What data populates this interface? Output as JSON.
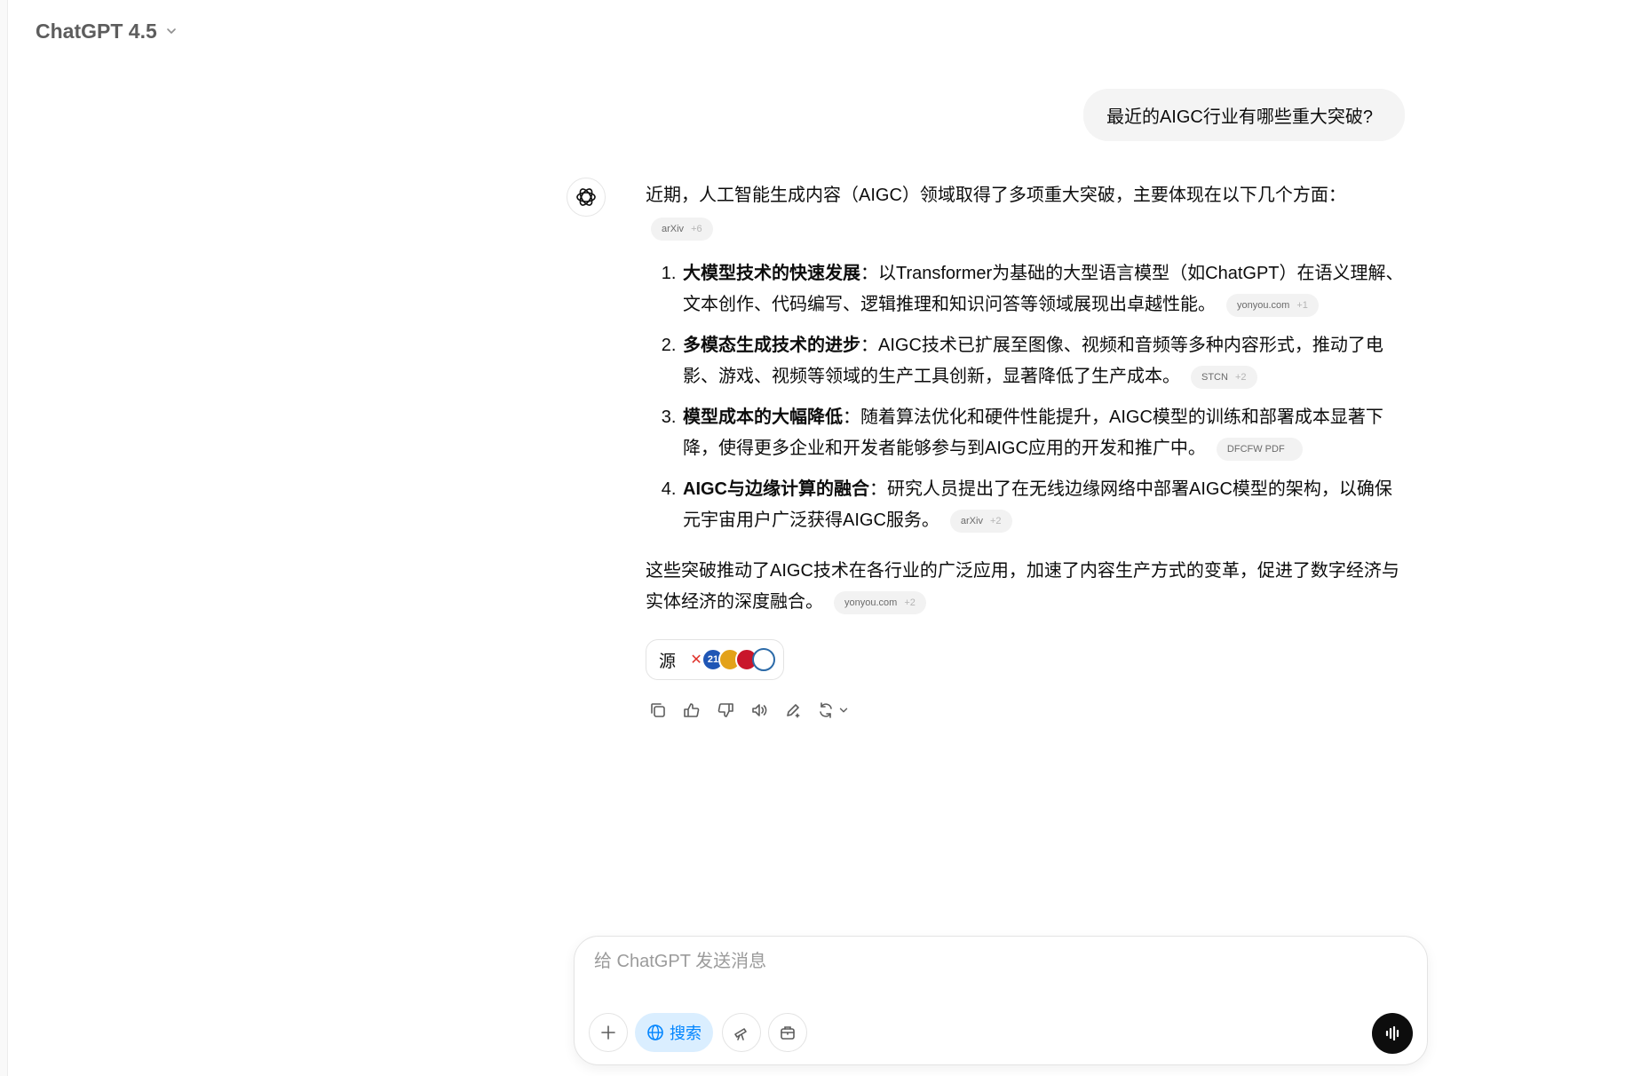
{
  "header": {
    "model_name": "ChatGPT 4.5"
  },
  "user_message": "最近的AIGC行业有哪些重大突破?",
  "assistant": {
    "intro": "近期，人工智能生成内容（AIGC）领域取得了多项重大突破，主要体现在以下几个方面：",
    "intro_chip": {
      "source": "arXiv",
      "more": "+6"
    },
    "points": [
      {
        "term": "大模型技术的快速发展",
        "text": "：以Transformer为基础的大型语言模型（如ChatGPT）在语义理解、文本创作、代码编写、逻辑推理和知识问答等领域展现出卓越性能。",
        "chip_source": "yonyou.com",
        "chip_more": "+1"
      },
      {
        "term": "多模态生成技术的进步",
        "text": "：AIGC技术已扩展至图像、视频和音频等多种内容形式，推动了电影、游戏、视频等领域的生产工具创新，显著降低了生产成本。",
        "chip_source": "STCN",
        "chip_more": "+2"
      },
      {
        "term": "模型成本的大幅降低",
        "text": "：随着算法优化和硬件性能提升，AIGC模型的训练和部署成本显著下降，使得更多企业和开发者能够参与到AIGC应用的开发和推广中。",
        "chip_source": "DFCFW PDF",
        "chip_more": ""
      },
      {
        "term": "AIGC与边缘计算的融合",
        "text": "：研究人员提出了在无线边缘网络中部署AIGC模型的架构，以确保元宇宙用户广泛获得AIGC服务。",
        "chip_source": "arXiv",
        "chip_more": "+2"
      }
    ],
    "summary": "这些突破推动了AIGC技术在各行业的广泛应用，加速了内容生产方式的变革，促进了数字经济与实体经济的深度融合。",
    "summary_chip": {
      "source": "yonyou.com",
      "more": "+2"
    },
    "sources_label": "源",
    "source_favicons": [
      {
        "icon": "x-icon",
        "color": "#e0322b"
      },
      {
        "icon": "21-icon",
        "color": "#1f56b5"
      },
      {
        "icon": "hk-icon",
        "color": "#e3a21a"
      },
      {
        "icon": "red-circle-icon",
        "color": "#c9162b"
      },
      {
        "icon": "ring-icon",
        "color": "#2b6aa8"
      }
    ]
  },
  "composer": {
    "placeholder": "给 ChatGPT 发送消息",
    "search_label": "搜索"
  },
  "accent": {
    "search_bg": "#daeeff",
    "search_fg": "#0285ff"
  }
}
